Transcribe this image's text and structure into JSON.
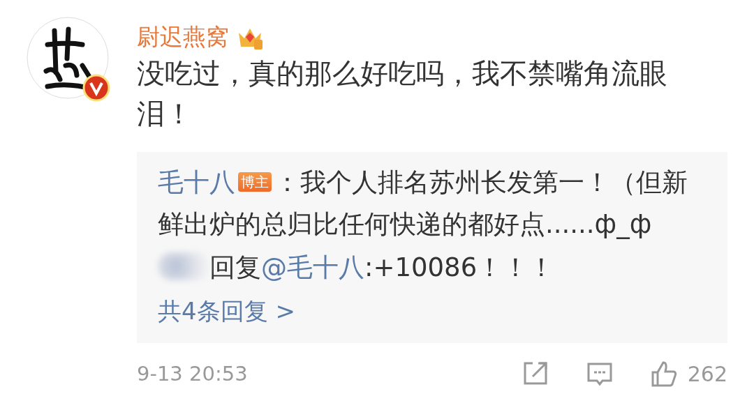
{
  "comment": {
    "author": "尉迟燕窝",
    "verified": true,
    "text": "没吃过，真的那么好吃吗，我不禁嘴角流眼泪！"
  },
  "replies": [
    {
      "kind": "comment",
      "author": "毛十八",
      "badge": "博主",
      "text": "：我个人排名苏州长发第一！（但新鲜出炉的总归比任何快递的都好点......ф_ф"
    },
    {
      "kind": "reply",
      "verb": "回复",
      "target": "@毛十八",
      "text": ":+10086！！！"
    }
  ],
  "more_replies": "共4条回复 >",
  "footer": {
    "time": "9-13 20:53",
    "likes": "262"
  }
}
